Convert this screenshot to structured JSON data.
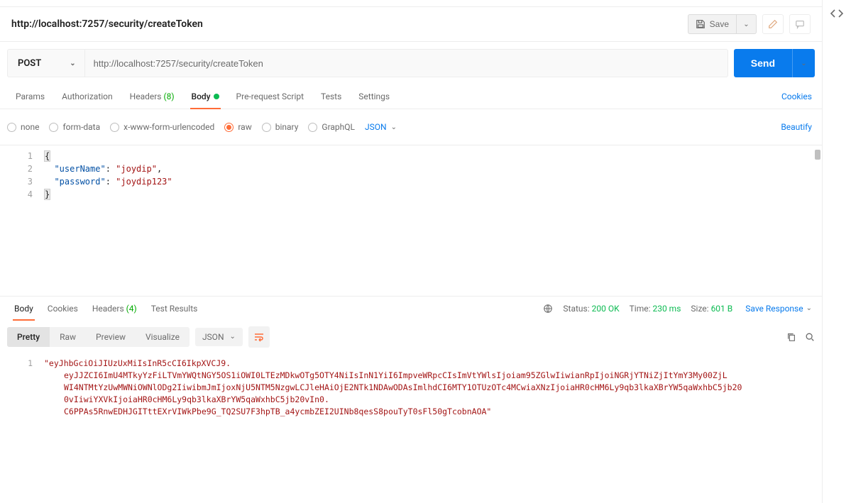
{
  "title": "http://localhost:7257/security/createToken",
  "save_label": "Save",
  "method": "POST",
  "url": "http://localhost:7257/security/createToken",
  "send_label": "Send",
  "cookies_link": "Cookies",
  "beautify_link": "Beautify",
  "req_tabs": {
    "params": "Params",
    "auth": "Authorization",
    "headers": "Headers",
    "headers_count": "(8)",
    "body": "Body",
    "prereq": "Pre-request Script",
    "tests": "Tests",
    "settings": "Settings"
  },
  "body_types": {
    "none": "none",
    "formdata": "form-data",
    "xwww": "x-www-form-urlencoded",
    "raw": "raw",
    "binary": "binary",
    "graphql": "GraphQL"
  },
  "body_format": "JSON",
  "request_body": {
    "lines": [
      "1",
      "2",
      "3",
      "4"
    ],
    "userName_key": "\"userName\"",
    "userName_val": "\"joydip\"",
    "password_key": "\"password\"",
    "password_val": "\"joydip123\""
  },
  "resp_tabs": {
    "body": "Body",
    "cookies": "Cookies",
    "headers": "Headers",
    "headers_count": "(4)",
    "tests": "Test Results"
  },
  "status": {
    "status_label": "Status:",
    "status_val": "200 OK",
    "time_label": "Time:",
    "time_val": "230 ms",
    "size_label": "Size:",
    "size_val": "601 B"
  },
  "save_response": "Save Response",
  "view_modes": {
    "pretty": "Pretty",
    "raw": "Raw",
    "preview": "Preview",
    "visualize": "Visualize"
  },
  "resp_format": "JSON",
  "response_lines": [
    "1"
  ],
  "response_text": {
    "l1": "\"eyJhbGciOiJIUzUxMiIsInR5cCI6IkpXVCJ9.",
    "l2": "eyJJZCI6ImU4MTkyYzFiLTVmYWQtNGY5OS1iOWI0LTEzMDkwOTg5OTY4NiIsInN1YiI6ImpveWRpcCIsImVtYWlsIjoiam95ZGlwIiwianRpIjoiNGRjYTNiZjItYmY3My00ZjL",
    "l3": "WI4NTMtYzUwMWNiOWNlODg2IiwibmJmIjoxNjU5NTM5NzgwLCJleHAiOjE2NTk1NDAwODAsImlhdCI6MTY1OTUzOTc4MCwiaXNzIjoiaHR0cHM6Ly9qb3lkaXBrYW5qaWxhbC5jb20",
    "l4": "0vIiwiYXVkIjoiaHR0cHM6Ly9qb3lkaXBrYW5qaWxhbC5jb20vIn0.",
    "l5": "C6PPAs5RnwEDHJGITttEXrVIWkPbe9G_TQ2SU7F3hpTB_a4ycmbZEI2UINb8qesS8pouTyT0sFl50gTcobnAOA\""
  }
}
